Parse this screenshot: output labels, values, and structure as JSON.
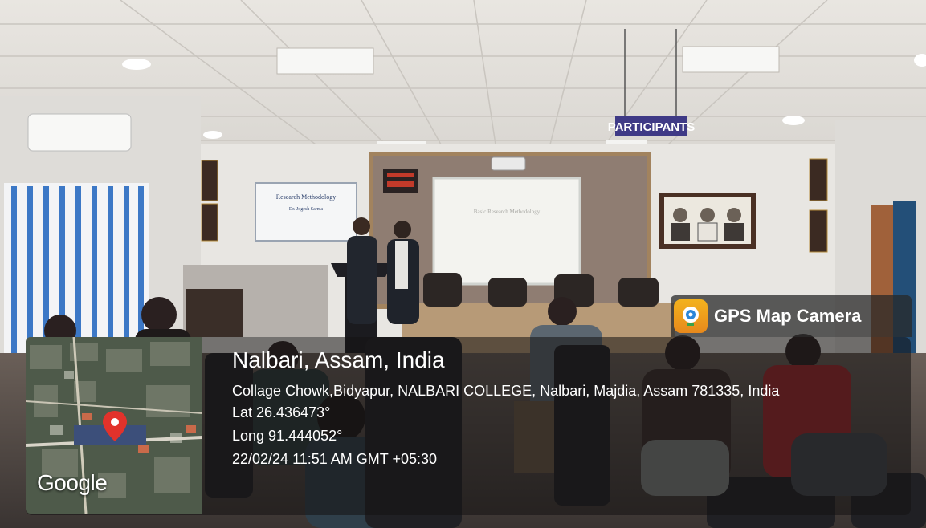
{
  "photo": {
    "description_labels": {
      "board_sign": "PARTICIPANTS",
      "left_screen_title": "Research Methodology",
      "left_screen_subtitle": "Dr. Jogesh Sarma",
      "right_screen_title": "Basic Research Methodology"
    }
  },
  "overlay": {
    "app_name": "GPS Map Camera",
    "map_brand": "Google",
    "location_title": "Nalbari, Assam, India",
    "address": "Collage Chowk,Bidyapur, NALBARI COLLEGE, Nalbari, Majdia, Assam 781335, India",
    "latitude": "Lat 26.436473°",
    "longitude": "Long 91.444052°",
    "timestamp": "22/02/24 11:51 AM GMT +05:30"
  },
  "colors": {
    "badge_icon": "#f3b21d",
    "map_pin": "#e2322b"
  }
}
